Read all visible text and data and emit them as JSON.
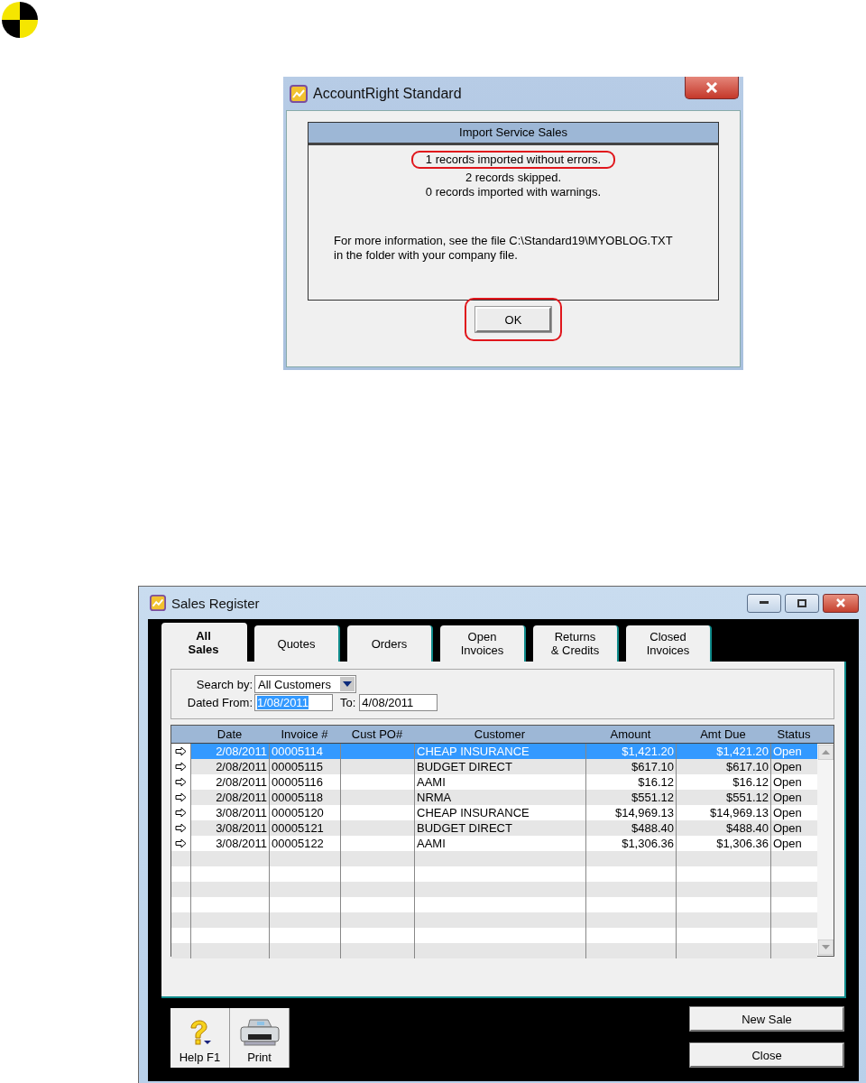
{
  "dialog": {
    "title": "AccountRight Standard",
    "heading": "Import Service Sales",
    "messages": [
      {
        "text": "1 records imported without errors.",
        "highlighted": true
      },
      {
        "text": "2 records skipped.",
        "highlighted": false
      },
      {
        "text": "0 records imported with warnings.",
        "highlighted": false
      }
    ],
    "note_lines": [
      "For more information, see the file C:\\Standard19\\MYOBLOG.TXT",
      "in the folder with your company file."
    ],
    "ok_button": {
      "label": "OK",
      "highlighted": true
    }
  },
  "window": {
    "title": "Sales Register"
  },
  "tabs": [
    {
      "lines": [
        "All",
        "Sales"
      ],
      "selected": true
    },
    {
      "lines": [
        "Quotes"
      ],
      "selected": false
    },
    {
      "lines": [
        "Orders"
      ],
      "selected": false
    },
    {
      "lines": [
        "Open",
        "Invoices"
      ],
      "selected": false
    },
    {
      "lines": [
        "Returns",
        "& Credits"
      ],
      "selected": false
    },
    {
      "lines": [
        "Closed",
        "Invoices"
      ],
      "selected": false
    }
  ],
  "filters": {
    "search_by": {
      "label": "Search by:",
      "value": "All Customers"
    },
    "dated_from": {
      "label": "Dated From:",
      "value": "1/08/2011",
      "text_selected": true
    },
    "to": {
      "label": "To:",
      "value": "4/08/2011"
    }
  },
  "table": {
    "columns": [
      "Date",
      "Invoice #",
      "Cust PO#",
      "Customer",
      "Amount",
      "Amt Due",
      "Status"
    ],
    "rows": [
      {
        "date": "2/08/2011",
        "invoice": "00005114",
        "customer": "CHEAP INSURANCE",
        "amount": "$1,421.20",
        "amt_due": "$1,421.20",
        "status": "Open",
        "selected": true
      },
      {
        "date": "2/08/2011",
        "invoice": "00005115",
        "customer": "BUDGET DIRECT",
        "amount": "$617.10",
        "amt_due": "$617.10",
        "status": "Open",
        "selected": false
      },
      {
        "date": "2/08/2011",
        "invoice": "00005116",
        "customer": "AAMI",
        "amount": "$16.12",
        "amt_due": "$16.12",
        "status": "Open",
        "selected": false
      },
      {
        "date": "2/08/2011",
        "invoice": "00005118",
        "customer": "NRMA",
        "amount": "$551.12",
        "amt_due": "$551.12",
        "status": "Open",
        "selected": false
      },
      {
        "date": "3/08/2011",
        "invoice": "00005120",
        "customer": "CHEAP INSURANCE",
        "amount": "$14,969.13",
        "amt_due": "$14,969.13",
        "status": "Open",
        "selected": false
      },
      {
        "date": "3/08/2011",
        "invoice": "00005121",
        "customer": "BUDGET DIRECT",
        "amount": "$488.40",
        "amt_due": "$488.40",
        "status": "Open",
        "selected": false
      },
      {
        "date": "3/08/2011",
        "invoice": "00005122",
        "customer": "AAMI",
        "amount": "$1,306.36",
        "amt_due": "$1,306.36",
        "status": "Open",
        "selected": false
      }
    ]
  },
  "toolbar": [
    {
      "kind": "help",
      "label": "Help F1"
    },
    {
      "kind": "print",
      "label": "Print"
    }
  ],
  "buttons": [
    "New Sale",
    "Close"
  ]
}
